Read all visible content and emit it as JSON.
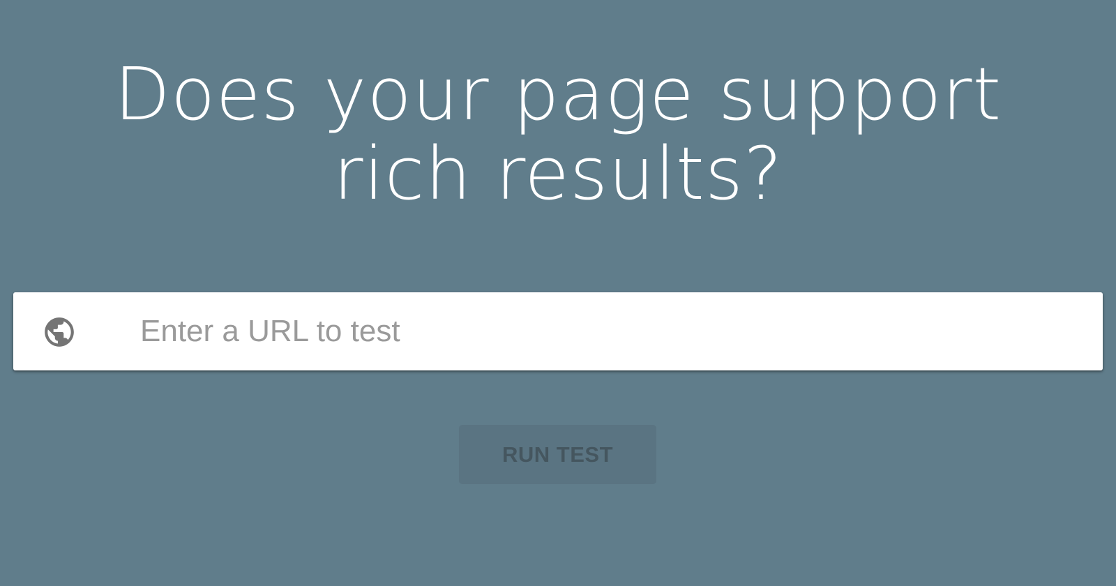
{
  "hero": {
    "title": "Does your page support rich results?"
  },
  "search": {
    "placeholder": "Enter a URL to test",
    "value": "",
    "icon": "globe-icon"
  },
  "actions": {
    "run_label": "RUN TEST"
  },
  "colors": {
    "background": "#607d8b",
    "input_background": "#ffffff",
    "placeholder_text": "#9a9a9a",
    "icon_gray": "#757575",
    "button_disabled_bg": "#5a7482",
    "button_disabled_text": "#45565f"
  }
}
